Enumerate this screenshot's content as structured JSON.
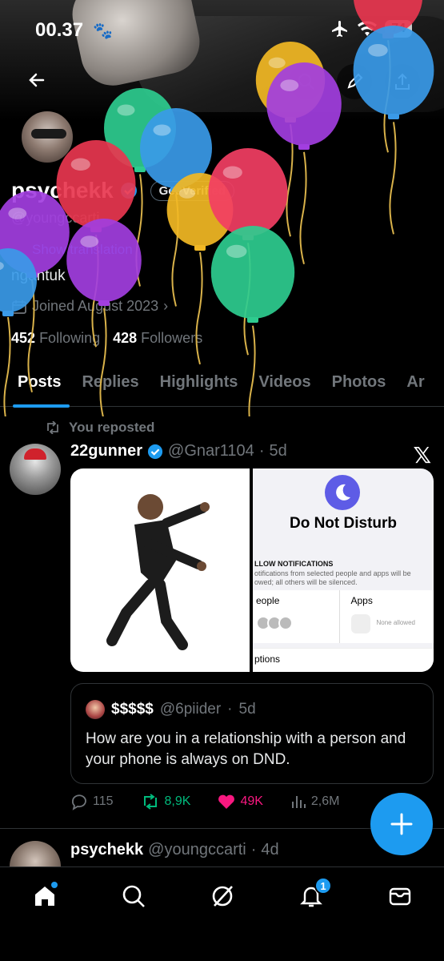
{
  "status": {
    "time": "00.37",
    "battery": "74"
  },
  "profile": {
    "name": "psychekk",
    "get_verified": "Get Verified",
    "handle": "@youngccarti",
    "show_translation": "Show translation",
    "bio": "ngantuk",
    "joined": "Joined August 2023",
    "following_count": "452",
    "following_label": "Following",
    "followers_count": "428",
    "followers_label": "Followers"
  },
  "tabs": [
    "Posts",
    "Replies",
    "Highlights",
    "Videos",
    "Photos",
    "Ar"
  ],
  "post": {
    "repost_label": "You reposted",
    "author": "22gunner",
    "handle": "@Gnar1104",
    "time": "5d",
    "media_right": {
      "title": "Do Not Disturb",
      "subheading": "LLOW NOTIFICATIONS",
      "description": "otifications from selected people and apps will be owed; all others will be silenced.",
      "people_label": "eople",
      "apps_label": "Apps",
      "none_allowed": "None allowed",
      "options_label": "ptions"
    },
    "quote": {
      "author": "$$$$$",
      "handle": "@6piider",
      "time": "5d",
      "text": "How are you in a relationship with a person and your phone is always on DND."
    },
    "stats": {
      "replies": "115",
      "reposts": "8,9K",
      "likes": "49K",
      "views": "2,6M"
    }
  },
  "post2": {
    "author": "psychekk",
    "handle": "@youngccarti",
    "time": "4d"
  },
  "nav": {
    "notifications_badge": "1"
  },
  "colors": {
    "accent": "#1d9bf0",
    "repost": "#00ba7c",
    "like": "#f91880"
  },
  "balloon_colors": [
    "#e8364f",
    "#2ecc8f",
    "#3a9ae8",
    "#f2b824",
    "#a23ee0",
    "#f23e63"
  ]
}
